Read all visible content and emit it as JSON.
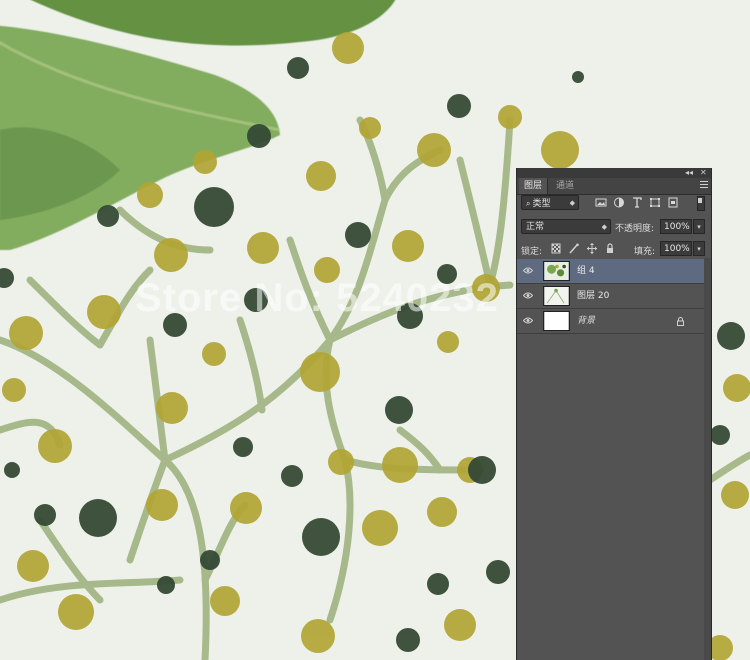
{
  "watermark": "Store No: 5240232",
  "panel": {
    "title_buttons": {
      "collapse": "◂◂",
      "close": "✕"
    },
    "tabs": [
      {
        "label": "图层",
        "active": true
      },
      {
        "label": "通道",
        "active": false
      }
    ],
    "filter": {
      "label": "类型",
      "icons": [
        "image-filter-icon",
        "adjustment-filter-icon",
        "type-filter-icon",
        "shape-filter-icon",
        "smart-object-filter-icon"
      ]
    },
    "blend_mode": "正常",
    "opacity": {
      "label": "不透明度:",
      "value": "100%"
    },
    "lock": {
      "label": "锁定:",
      "icons": [
        "lock-transparent-icon",
        "lock-image-icon",
        "lock-position-icon",
        "lock-all-icon"
      ]
    },
    "fill": {
      "label": "填充:",
      "value": "100%"
    },
    "layers": [
      {
        "name": "组 4",
        "selected": true,
        "visible": true,
        "locked": false
      },
      {
        "name": "图层 20",
        "selected": false,
        "visible": true,
        "locked": false
      },
      {
        "name": "背景",
        "selected": false,
        "visible": true,
        "locked": true
      }
    ]
  },
  "colors": {
    "panel_bg": "#535353",
    "selected_row": "#5d6a80",
    "leaf_green": "#6e9a45",
    "dot_mustard": "#b2a534",
    "dot_dark": "#354a35",
    "stem": "#9bb07a"
  }
}
